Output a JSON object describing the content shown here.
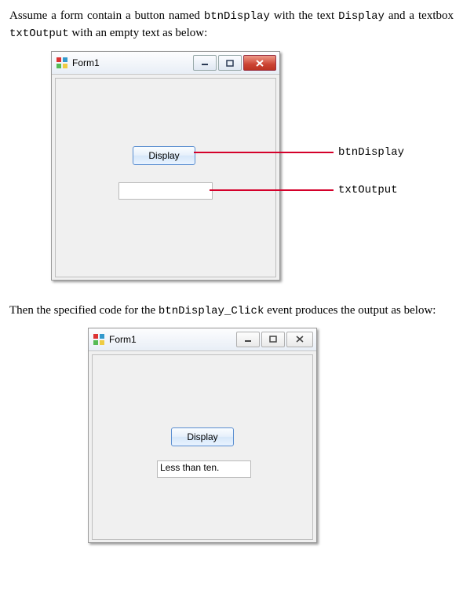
{
  "intro_parts": {
    "a": "Assume a form contain a button named ",
    "b": "btnDisplay",
    "c": " with the text ",
    "d": "Display",
    "e": " and a textbox ",
    "f": "txtOutput",
    "g": " with an empty text as below:"
  },
  "mid_parts": {
    "a": "Then the specified code for the ",
    "b": "btnDisplay_Click",
    "c": " event produces the output as below:"
  },
  "form1": {
    "title": "Form1",
    "button_label": "Display",
    "textbox_value": ""
  },
  "form2": {
    "title": "Form1",
    "button_label": "Display",
    "textbox_value": "Less than ten."
  },
  "annotations": {
    "btn": "btnDisplay",
    "txt": "txtOutput"
  }
}
